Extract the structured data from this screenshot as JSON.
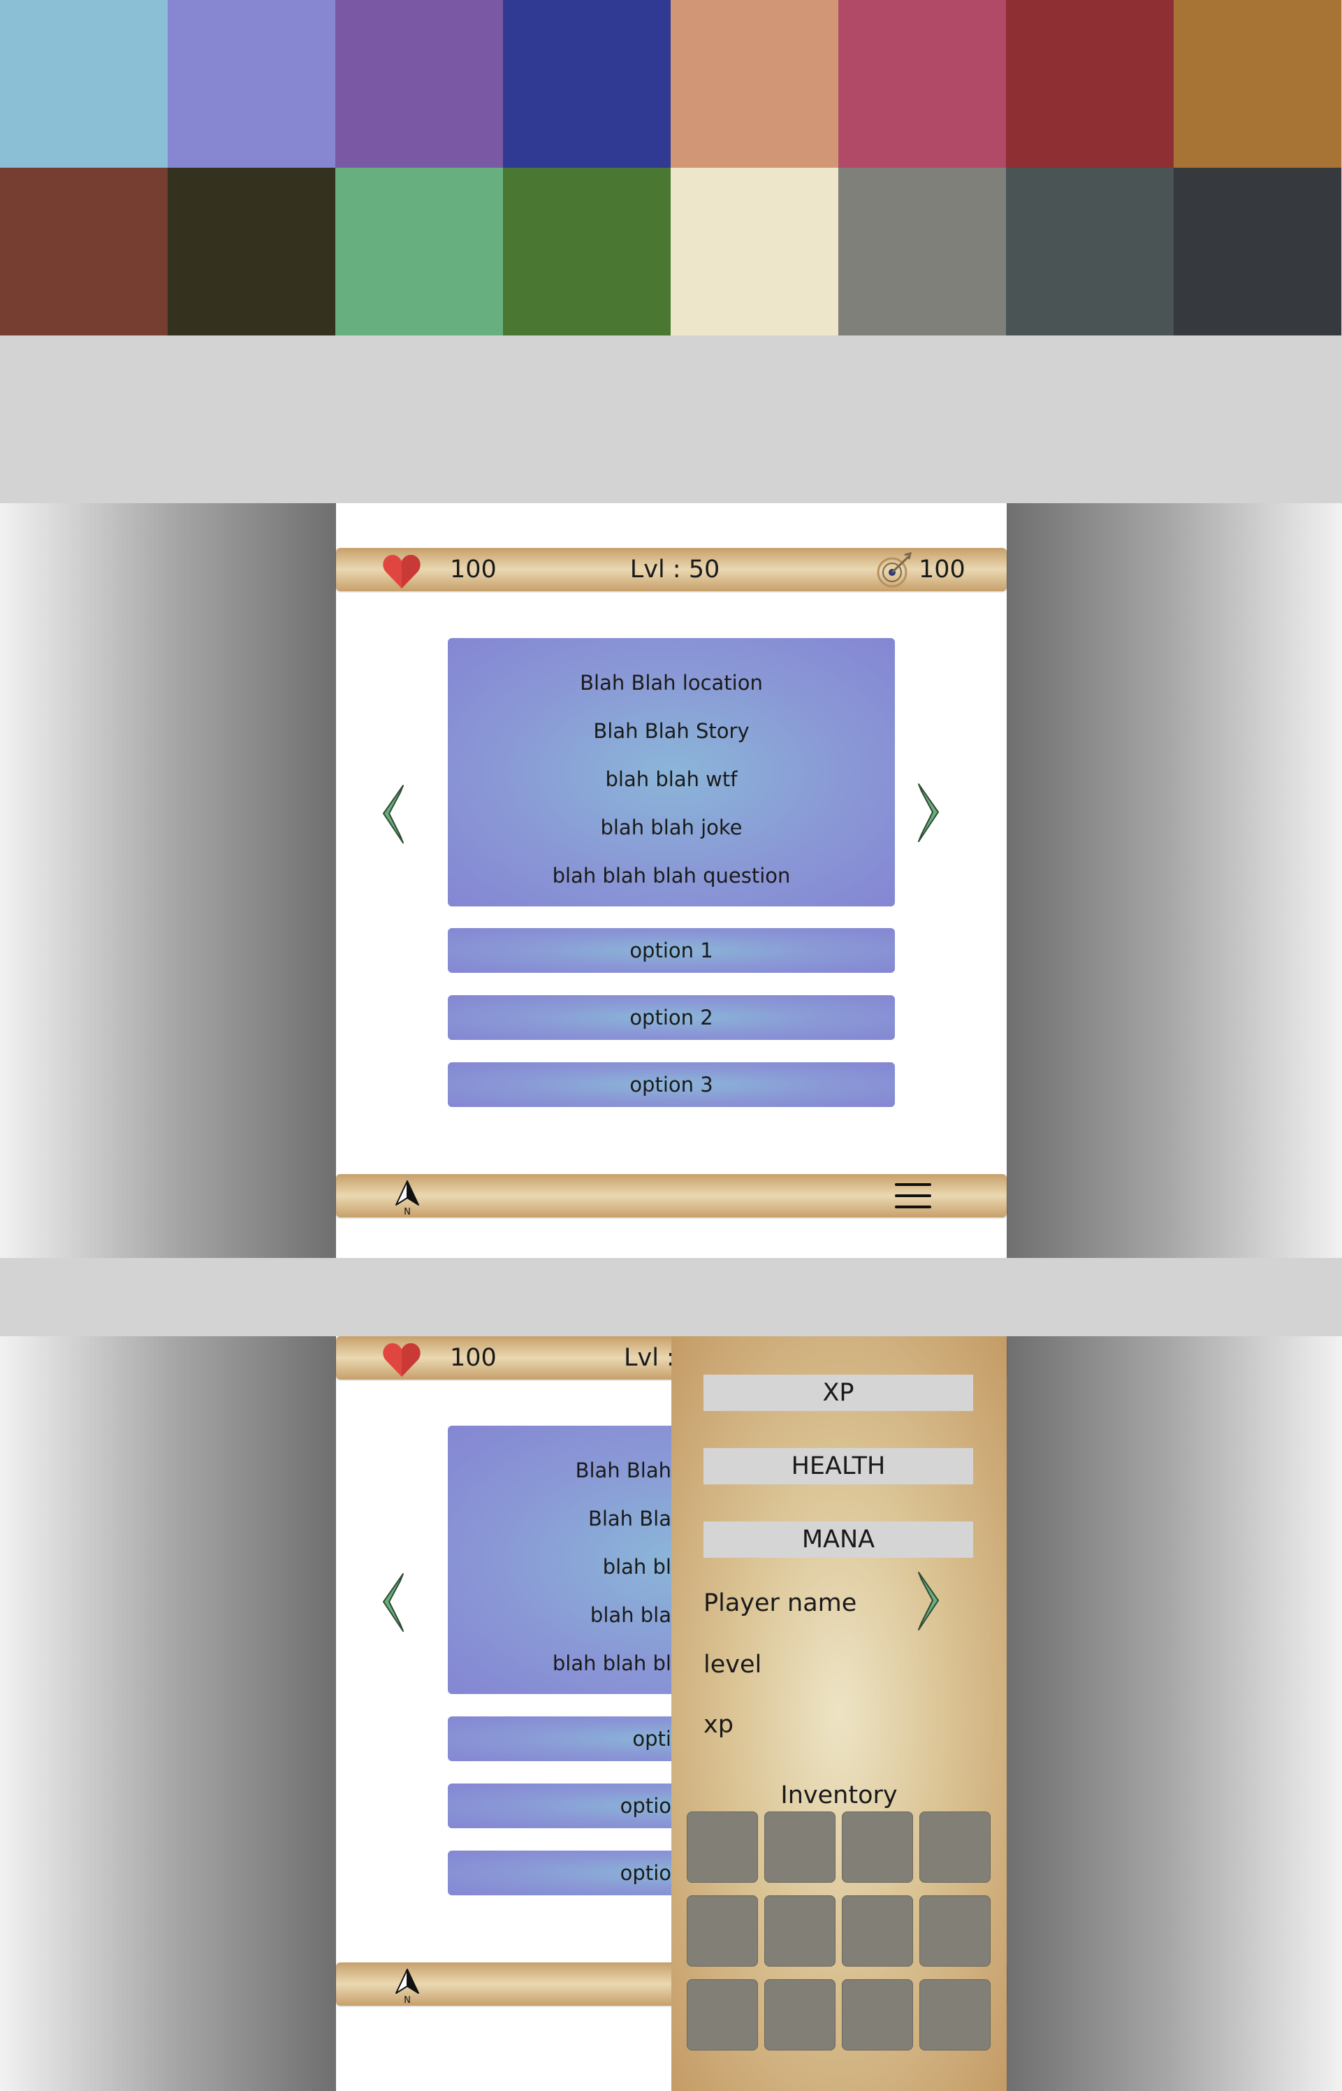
{
  "palette": {
    "colors": [
      "#8ABFD6",
      "#8787D1",
      "#7A58A4",
      "#303A92",
      "#D19676",
      "#B04A66",
      "#8E2F33",
      "#A87435",
      "#753E31",
      "#34311E",
      "#67AF7E",
      "#4A7732",
      "#EDE6CA",
      "#80807A",
      "#4A5455",
      "#363A3E"
    ]
  },
  "hud": {
    "health_icon": "heart-icon",
    "health_value": "100",
    "level_text": "Lvl : 50",
    "mana_icon": "target-icon",
    "mana_value": "100",
    "level_text_partial": "Lvl :"
  },
  "story": {
    "lines": [
      "Blah Blah location",
      "Blah Blah Story",
      "blah blah wtf",
      "blah blah joke",
      "blah blah blah question"
    ],
    "lines_partial": [
      "Blah Blah",
      "Blah Bla",
      "blah bl",
      "blah bla",
      "blah blah bl"
    ]
  },
  "options": [
    "option 1",
    "option 2",
    "option 3"
  ],
  "options_partial": [
    "opti",
    "optio",
    "optio"
  ],
  "nav": {
    "prev_icon": "chevron-left-icon",
    "next_icon": "chevron-right-icon",
    "compass_icon": "north-arrow-icon",
    "compass_label": "N",
    "menu_icon": "hamburger-menu-icon"
  },
  "drawer": {
    "xp_label": "XP",
    "health_label": "HEALTH",
    "mana_label": "MANA",
    "player_name": "Player name",
    "level": "level",
    "xp": "xp",
    "inventory_title": "Inventory",
    "inventory_slots": 12
  }
}
